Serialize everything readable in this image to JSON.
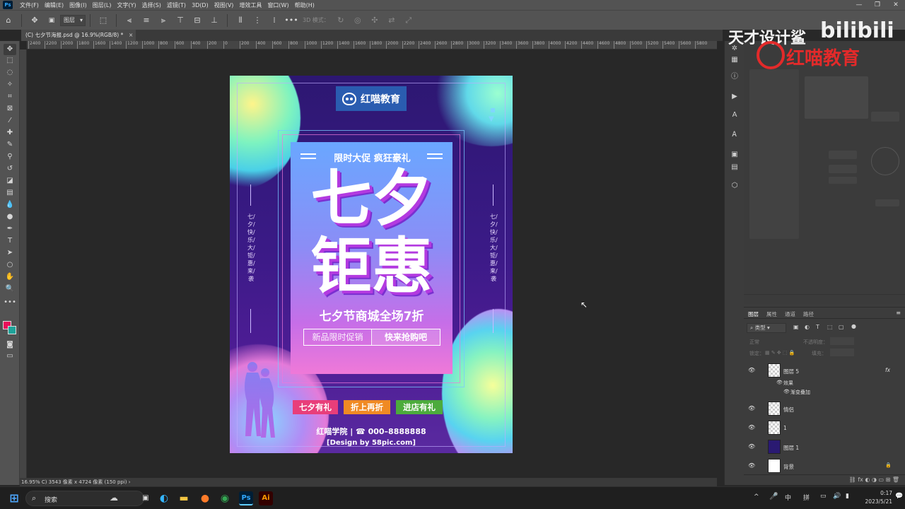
{
  "menubar": {
    "items": [
      "文件(F)",
      "编辑(E)",
      "图像(I)",
      "图层(L)",
      "文字(Y)",
      "选择(S)",
      "滤镜(T)",
      "3D(D)",
      "视图(V)",
      "增效工具",
      "窗口(W)",
      "帮助(H)"
    ]
  },
  "optionsbar": {
    "layer_select": "图层",
    "mode_3d": "3D 模式："
  },
  "document": {
    "tab_title": "(C) 七夕节海报.psd @ 16.9%(RGB/8) *",
    "close_glyph": "×"
  },
  "ruler": {
    "h_ticks": [
      "2400",
      "2200",
      "2000",
      "1800",
      "1600",
      "1400",
      "1200",
      "1000",
      "800",
      "600",
      "400",
      "200",
      "0",
      "200",
      "400",
      "600",
      "800",
      "1000",
      "1200",
      "1400",
      "1600",
      "1800",
      "2000",
      "2200",
      "2400",
      "2600",
      "2800",
      "3000",
      "3200",
      "3400",
      "3600",
      "3800",
      "4000",
      "4200",
      "4400",
      "4600",
      "4800",
      "5000",
      "5200",
      "5400",
      "5600",
      "5800"
    ]
  },
  "status": {
    "text": "16.95%  C) 3543 像素 x 4724 像素 (150 ppi)  ›"
  },
  "poster": {
    "logo_text": "红喵教育",
    "headline_small": "限时大促 疯狂豪礼",
    "title_line1": "七夕",
    "title_line2": "钜惠",
    "subtitle": "七夕节商城全场7折",
    "box_left": "新品限时促销",
    "box_right": "快来抢购吧",
    "vert_left": "七/夕/快/乐/大/钜/惠/来/袭",
    "vert_right": "七/夕/快/乐/大/钜/惠/来/袭",
    "tags": [
      "七夕有礼",
      "折上再折",
      "进店有礼"
    ],
    "tag_colors": [
      "#e83e7a",
      "#f08a24",
      "#4cab3c"
    ],
    "contact": "红喵学院 | ☎ 000–8888888",
    "design_by": "[Design by 58pic.com]"
  },
  "right_panel": {
    "layers_tabs": [
      "图层",
      "属性",
      "通道",
      "路径"
    ],
    "filter_label": "类型",
    "mode_label": "正常",
    "opacity_label": "不透明度：",
    "lock_label": "锁定：",
    "fill_label": "填充：",
    "layers": [
      {
        "name": "图层 5",
        "fx": "fx"
      },
      {
        "name": "效果"
      },
      {
        "name": "渐变叠加"
      },
      {
        "name": "情侣"
      },
      {
        "name": "1"
      },
      {
        "name": "图层 1"
      },
      {
        "name": "背景"
      }
    ]
  },
  "watermark": {
    "tiancai": "天才设计鲨",
    "bilibili": "bilibili",
    "hongmiao": "红喵教育"
  },
  "taskbar": {
    "search_label": "搜索",
    "ime_1": "中",
    "ime_2": "拼",
    "time": "0:17",
    "date": "2023/5/21",
    "ps_label": "Ps",
    "ai_label": "Ai"
  }
}
